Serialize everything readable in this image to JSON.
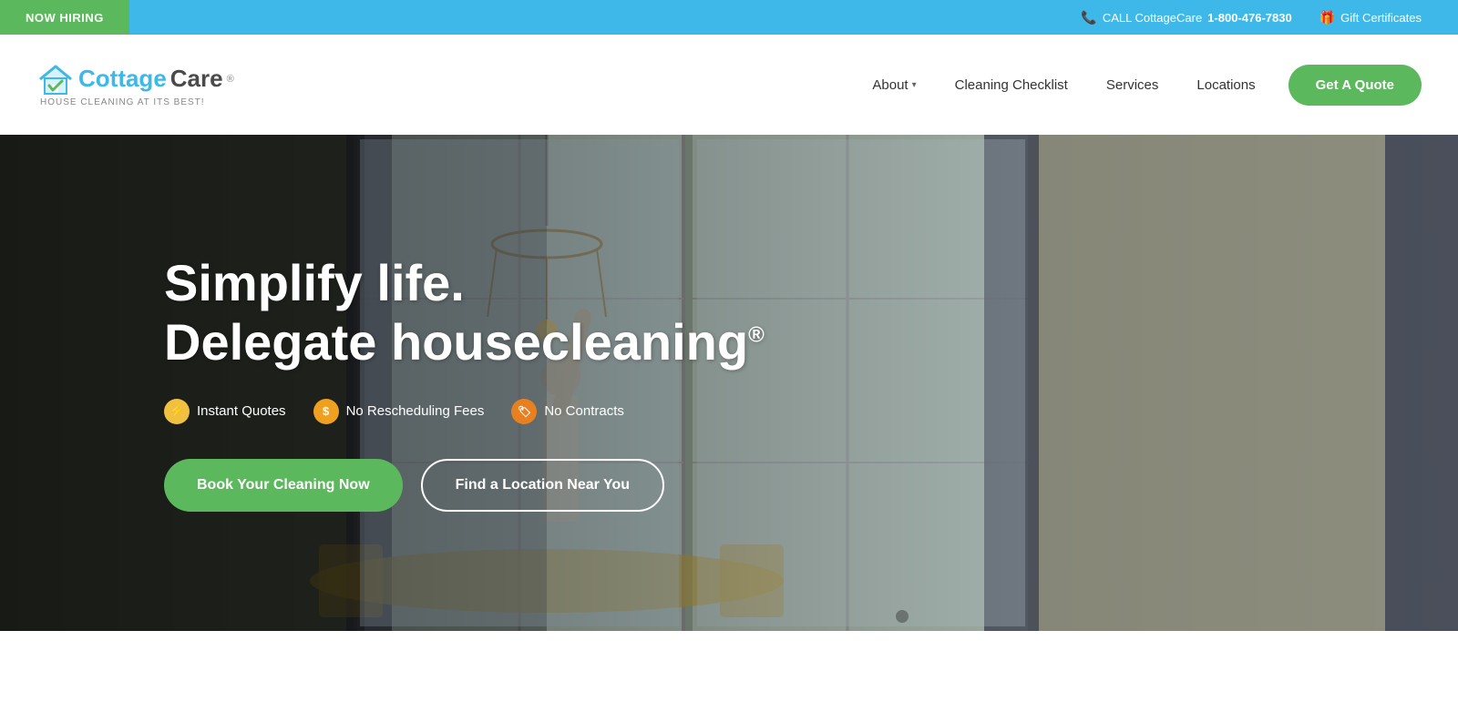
{
  "topbar": {
    "hiring_label": "NOW HIRING",
    "call_text": "CALL CottageCare",
    "phone_number": "1-800-476-7830",
    "gift_label": "Gift Certificates"
  },
  "header": {
    "logo": {
      "brand": "CottageCare",
      "registered": "®",
      "tagline": "HOUSE CLEANING AT ITS BEST!"
    },
    "nav": {
      "about_label": "About",
      "checklist_label": "Cleaning Checklist",
      "services_label": "Services",
      "locations_label": "Locations",
      "cta_label": "Get A Quote"
    }
  },
  "hero": {
    "title_line1": "Simplify life.",
    "title_line2": "Delegate housecleaning",
    "title_registered": "®",
    "feature1": "Instant Quotes",
    "feature2": "No Rescheduling Fees",
    "feature3": "No Contracts",
    "btn_primary": "Book Your Cleaning Now",
    "btn_secondary": "Find a Location Near You"
  },
  "icons": {
    "phone": "📞",
    "gift": "🎁",
    "lightning": "⚡",
    "dollar": "$",
    "tag": "🏷"
  }
}
